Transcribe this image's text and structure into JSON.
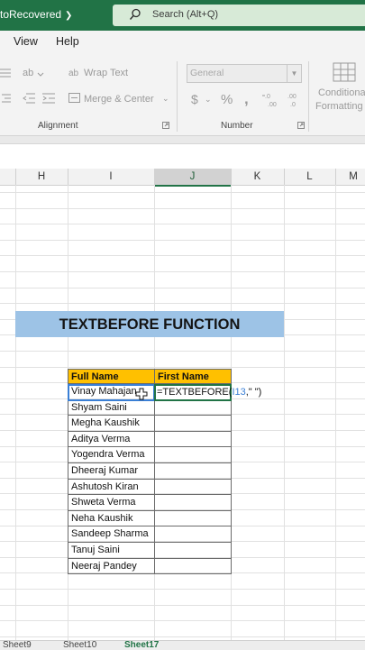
{
  "titlebar": {
    "autosave_text": "toRecovered",
    "search_placeholder": "Search (Alt+Q)"
  },
  "menu": {
    "view": "View",
    "help": "Help"
  },
  "ribbon": {
    "wrap_text": "Wrap Text",
    "merge_center": "Merge & Center",
    "alignment_label": "Alignment",
    "number_format": "General",
    "currency": "$",
    "percent": "%",
    "comma": ",",
    "number_label": "Number",
    "conditional_line1": "Conditional",
    "conditional_line2": "Formatting"
  },
  "columns": [
    "H",
    "I",
    "J",
    "K",
    "L",
    "M"
  ],
  "banner": "TEXTBEFORE FUNCTION",
  "table": {
    "headers": [
      "Full Name",
      "First Name"
    ],
    "names": [
      "Vinay Mahajan",
      "Shyam Saini",
      "Megha Kaushik",
      "Aditya Verma",
      "Yogendra Verma",
      "Dheeraj Kumar",
      "Ashutosh Kiran",
      "Shweta Verma",
      "Neha Kaushik",
      "Sandeep Sharma",
      "Tanuj Saini",
      "Neeraj Pandey"
    ]
  },
  "formula": {
    "prefix": "=TEXTBEFORE(",
    "ref": "I13",
    "suffix": ",\" \")"
  },
  "sheet_tabs": [
    "Sheet9",
    "Sheet10",
    "Sheet17"
  ]
}
